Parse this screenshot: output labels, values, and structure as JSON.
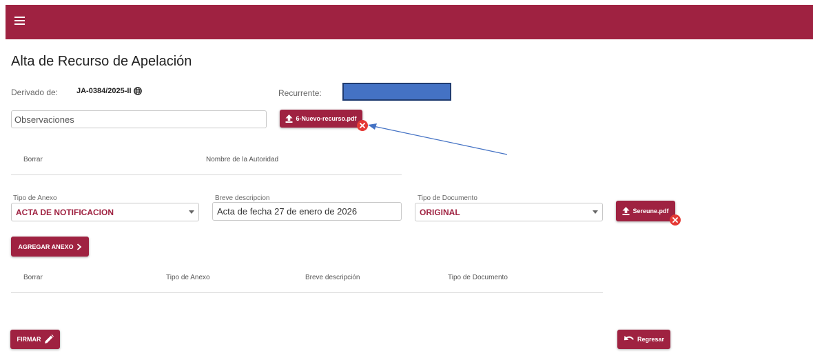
{
  "colors": {
    "brand": "#9f2241",
    "danger": "#e53935",
    "redaction": "#4472c4"
  },
  "header": {
    "menu_icon": "hamburger-menu-icon"
  },
  "page": {
    "title": "Alta de Recurso de Apelación"
  },
  "info": {
    "derivado_label": "Derivado de:",
    "derivado_value": "JA-0384/2025-II",
    "derivado_icon": "globe-icon",
    "recurrente_label": "Recurrente:"
  },
  "observaciones": {
    "placeholder": "Observaciones",
    "value": ""
  },
  "upload_recurso": {
    "file_name": "6-Nuevo-recurso.pdf",
    "icon": "upload-icon",
    "remove_icon": "remove-x-icon"
  },
  "autoridad_table": {
    "columns": [
      "Borrar",
      "Nombre de la Autoridad"
    ]
  },
  "anexo_form": {
    "tipo_anexo": {
      "label": "Tipo de Anexo",
      "value": "ACTA DE NOTIFICACION"
    },
    "breve": {
      "label": "Breve descripcion",
      "value": "Acta de fecha 27 de enero de 2026"
    },
    "tipo_documento": {
      "label": "Tipo de Documento",
      "value": "ORIGINAL"
    },
    "upload": {
      "file_name": "Sereune.pdf",
      "icon": "upload-icon",
      "remove_icon": "remove-x-icon"
    }
  },
  "agregar_anexo": {
    "label": "AGREGAR ANEXO",
    "icon": "chevron-right-icon"
  },
  "anexos_table": {
    "columns": [
      "Borrar",
      "Tipo de Anexo",
      "Breve descripción",
      "Tipo de Documento"
    ]
  },
  "footer": {
    "firmar_label": "FIRMAR",
    "firmar_icon": "pencil-icon",
    "regresar_label": "Regresar",
    "regresar_icon": "undo-icon"
  }
}
